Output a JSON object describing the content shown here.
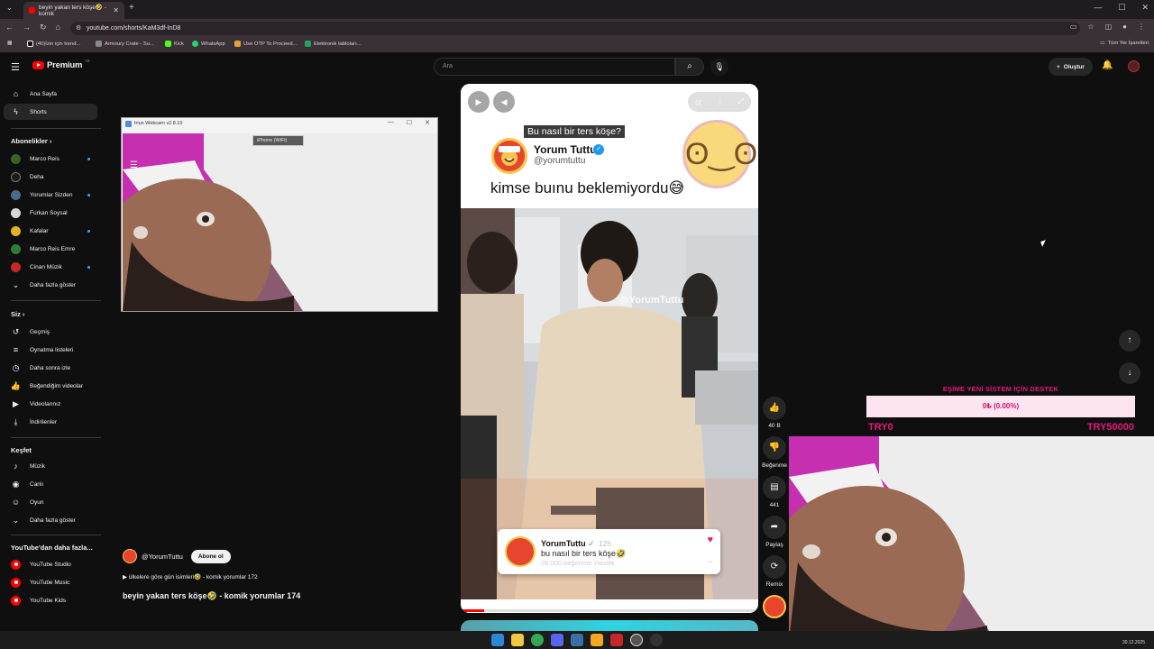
{
  "browser": {
    "tab_title": "beyin yakan ters köşe🤣 - komik",
    "url": "youtube.com/shorts/KaM3df-InD8",
    "bookmarks": [
      "(40)İzin için trend...",
      "Armoury Crate - Su...",
      "Kick",
      "WhatsApp",
      "Use OTP To Proceed...",
      "Elektronik tabloları..."
    ],
    "all_bookmarks": "Tüm Yer İşaretleri"
  },
  "header": {
    "logo_text": "Premium",
    "logo_tm": "TR",
    "search_placeholder": "Ara",
    "create_label": "Oluştur"
  },
  "sidebar": {
    "main": [
      {
        "label": "Ana Sayfa",
        "icon": "home-icon"
      },
      {
        "label": "Shorts",
        "icon": "shorts-icon"
      }
    ],
    "subscriptions_heading": "Abonelikler",
    "subscriptions": [
      {
        "label": "Marco Reis",
        "color": "#3b5f2a",
        "dot": true
      },
      {
        "label": "Deha",
        "color": "#1a1a1a",
        "dot": false
      },
      {
        "label": "Yorumlar Sizden",
        "color": "#4a6a8a",
        "dot": true
      },
      {
        "label": "Furkan Soysal",
        "color": "#d6d6d6",
        "dot": false
      },
      {
        "label": "Kafalar",
        "color": "#e0b422",
        "dot": true
      },
      {
        "label": "Marco Reis Emre",
        "color": "#2e7d32",
        "dot": false
      },
      {
        "label": "Cinan Müzik",
        "color": "#c62828",
        "dot": true
      }
    ],
    "show_more_1": "Daha fazla göster",
    "you_heading": "Siz",
    "you": [
      {
        "label": "Geçmiş",
        "icon": "history-icon"
      },
      {
        "label": "Oynatma listeleri",
        "icon": "playlists-icon"
      },
      {
        "label": "Daha sonra izle",
        "icon": "watch-later-icon"
      },
      {
        "label": "Beğendiğim videolar",
        "icon": "liked-videos-icon"
      },
      {
        "label": "Videolarınız",
        "icon": "your-videos-icon"
      },
      {
        "label": "İndirilenler",
        "icon": "downloads-icon"
      }
    ],
    "explore_heading": "Keşfet",
    "explore": [
      {
        "label": "Müzik",
        "icon": "music-icon"
      },
      {
        "label": "Canlı",
        "icon": "live-icon"
      },
      {
        "label": "Oyun",
        "icon": "gaming-icon"
      }
    ],
    "show_more_2": "Daha fazla göster",
    "more_heading": "YouTube'dan daha fazla...",
    "more": [
      {
        "label": "YouTube Studio"
      },
      {
        "label": "YouTube Music"
      },
      {
        "label": "YouTube Kids"
      }
    ]
  },
  "webcam": {
    "title": "Iriun Webcam v2.8.10",
    "device": "iPhone (WiFi)"
  },
  "short": {
    "caption_question": "Bu nasıl bir ters köşe?",
    "channel_name": "Yorum Tuttu",
    "channel_handle": "@yorumtuttu",
    "headline": "kimse buınu beklemiyordu😅",
    "watermark": "@YorumTuttu",
    "comment": {
      "name": "YorumTuttu",
      "time": "12h",
      "text": "bu nasıl bir ters köşe🤣",
      "meta": "26.000 beğenme   Yanıtla"
    },
    "progress": 0.08
  },
  "actions": {
    "likes": "40 B",
    "dislike": "Beğenme",
    "comments": "441",
    "share": "Paylaş",
    "remix": "Remix"
  },
  "video_meta": {
    "channel": "@YorumTuttu",
    "subscribe": "Abone ol",
    "playlist": "▶  ülkelere göre gün isimleri🤣 - komik yorumlar 172",
    "title": "beyin yakan ters köşe🤣 - komik yorumlar 174"
  },
  "donation": {
    "title": "EŞİME YENİ SİSTEM İÇİN DESTEK",
    "progress_text": "0₺ (0.00%)",
    "min": "TRY0",
    "max": "TRY50000"
  },
  "taskbar": {
    "time": "30.12.2025"
  }
}
